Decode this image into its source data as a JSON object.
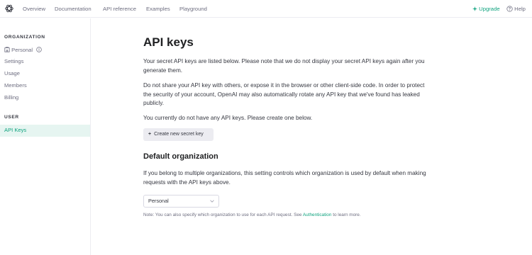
{
  "topbar": {
    "logo_icon": "openai-logo-icon",
    "nav": [
      "Overview",
      "Documentation",
      "API reference",
      "Examples",
      "Playground"
    ],
    "upgrade": "Upgrade",
    "help": "Help"
  },
  "sidebar": {
    "organization_title": "ORGANIZATION",
    "org_items": [
      "Personal",
      "Settings",
      "Usage",
      "Members",
      "Billing"
    ],
    "user_title": "USER",
    "user_items": [
      "API Keys"
    ]
  },
  "main": {
    "title": "API keys",
    "para1": "Your secret API keys are listed below. Please note that we do not display your secret API keys again after you generate them.",
    "para2": "Do not share your API key with others, or expose it in the browser or other client-side code. In order to protect the security of your account, OpenAI may also automatically rotate any API key that we've found has leaked publicly.",
    "para3": "You currently do not have any API keys. Please create one below.",
    "create_button": "Create new secret key",
    "default_org_title": "Default organization",
    "default_org_desc": "If you belong to multiple organizations, this setting controls which organization is used by default when making requests with the API keys above.",
    "select_value": "Personal",
    "note_prefix": "Note: You can also specify which organization to use for each API request. See",
    "note_link": "Authentication",
    "note_suffix": "to learn more."
  },
  "colors": {
    "accent": "#10a37f",
    "active_bg": "#e6f5f1",
    "text": "#353740",
    "muted": "#6e6e80"
  }
}
